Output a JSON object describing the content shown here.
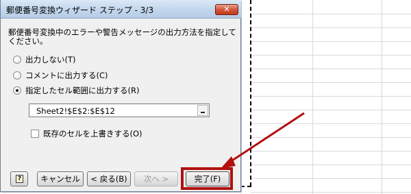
{
  "dialog": {
    "title": "郵便番号変換ウィザード ステップ - 3/3",
    "close_glyph": "✕",
    "instruction": "郵便番号変換中のエラーや警告メッセージの出力方法を指定してください。",
    "options": [
      {
        "label": "出力しない(T)",
        "checked": false
      },
      {
        "label": "コメントに出力する(C)",
        "checked": false
      },
      {
        "label": "指定したセル範囲に出力する(R)",
        "checked": true
      }
    ],
    "range_value": "Sheet2!$E$2:$E$12",
    "overwrite_label": "既存のセルを上書きする(O)",
    "overwrite_checked": false,
    "buttons": {
      "help_icon": "help-icon",
      "cancel": "キャンセル",
      "back": "< 戻る(B)",
      "next": "次へ >",
      "finish": "完了(F)"
    }
  },
  "annotation": {
    "color": "#b01010"
  },
  "colors": {
    "title_bar": "#c4d8ee",
    "close_button": "#c2391c",
    "dialog_bg": "#f0f0f0"
  }
}
